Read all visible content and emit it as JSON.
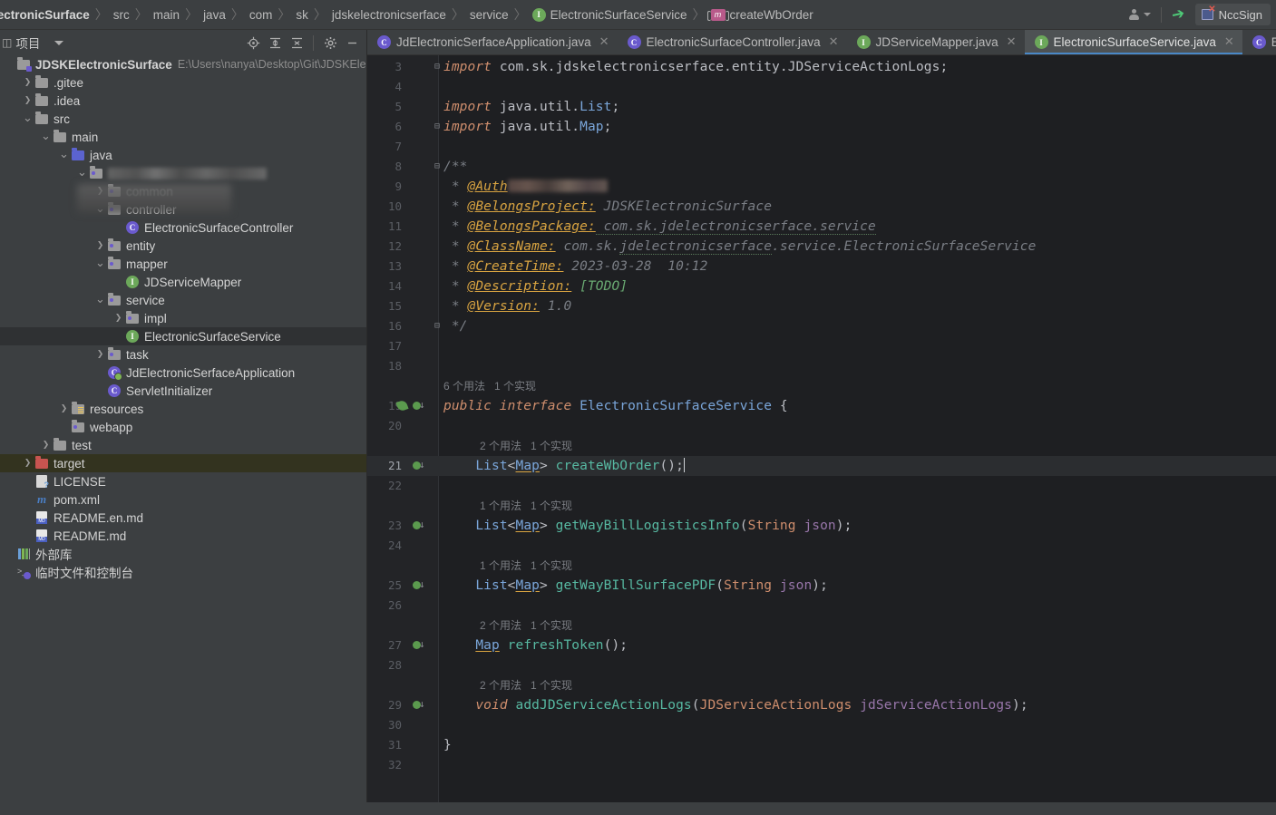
{
  "breadcrumb": {
    "items": [
      {
        "label": "lectronicSurface",
        "icon": null,
        "bold": true
      },
      {
        "label": "src",
        "icon": null
      },
      {
        "label": "main",
        "icon": null
      },
      {
        "label": "java",
        "icon": null
      },
      {
        "label": "com",
        "icon": null
      },
      {
        "label": "sk",
        "icon": null
      },
      {
        "label": "jdskelectronicserface",
        "icon": null
      },
      {
        "label": "service",
        "icon": null
      },
      {
        "label": "ElectronicSurfaceService",
        "icon": "interface-icon"
      },
      {
        "label": "createWbOrder",
        "icon": "method-icon"
      }
    ]
  },
  "topbar_right": {
    "user_icon": "user-icon",
    "hammer_icon": "build-hammer-icon",
    "ncc_sign_label": "NccSign",
    "ncc_sign_icon": "ncc-sign-icon"
  },
  "project_panel": {
    "title": "项目",
    "tools": [
      {
        "name": "locate-icon",
        "glyph": "target"
      },
      {
        "name": "expand-all-icon",
        "glyph": "expand"
      },
      {
        "name": "collapse-all-icon",
        "glyph": "collapse"
      },
      {
        "name": "settings-gear-icon",
        "glyph": "gear"
      },
      {
        "name": "hide-panel-icon",
        "glyph": "minus"
      }
    ],
    "tree": [
      {
        "indent": 0,
        "arrow": "",
        "icon": "project-root-icon",
        "label": "JDSKElectronicSurface",
        "bold": true,
        "sub": "E:\\Users\\nanya\\Desktop\\Git\\JDSKElectronicSurf"
      },
      {
        "indent": 1,
        "arrow": ">",
        "icon": "folder-icon",
        "label": ".gitee"
      },
      {
        "indent": 1,
        "arrow": ">",
        "icon": "folder-icon",
        "label": ".idea"
      },
      {
        "indent": 1,
        "arrow": "v",
        "icon": "folder-icon",
        "label": "src"
      },
      {
        "indent": 2,
        "arrow": "v",
        "icon": "folder-icon",
        "label": "main"
      },
      {
        "indent": 3,
        "arrow": "v",
        "icon": "source-folder-icon",
        "label": "java"
      },
      {
        "indent": 4,
        "arrow": "v",
        "icon": "package-icon",
        "label": "",
        "blurred": true
      },
      {
        "indent": 5,
        "arrow": ">",
        "icon": "package-icon",
        "label": "common",
        "blurred_partial": true
      },
      {
        "indent": 5,
        "arrow": "v",
        "icon": "package-icon",
        "label": "controller"
      },
      {
        "indent": 6,
        "arrow": "",
        "icon": "class-icon",
        "label": "ElectronicSurfaceController"
      },
      {
        "indent": 5,
        "arrow": ">",
        "icon": "package-icon",
        "label": "entity"
      },
      {
        "indent": 5,
        "arrow": "v",
        "icon": "package-icon",
        "label": "mapper"
      },
      {
        "indent": 6,
        "arrow": "",
        "icon": "interface-icon",
        "label": "JDServiceMapper"
      },
      {
        "indent": 5,
        "arrow": "v",
        "icon": "package-icon",
        "label": "service"
      },
      {
        "indent": 6,
        "arrow": ">",
        "icon": "package-icon",
        "label": "impl"
      },
      {
        "indent": 6,
        "arrow": "",
        "icon": "interface-icon",
        "label": "ElectronicSurfaceService",
        "selected": true
      },
      {
        "indent": 5,
        "arrow": ">",
        "icon": "package-icon",
        "label": "task"
      },
      {
        "indent": 5,
        "arrow": "",
        "icon": "spring-class-icon",
        "label": "JdElectronicSerfaceApplication"
      },
      {
        "indent": 5,
        "arrow": "",
        "icon": "class-icon",
        "label": "ServletInitializer"
      },
      {
        "indent": 3,
        "arrow": ">",
        "icon": "resources-folder-icon",
        "label": "resources"
      },
      {
        "indent": 3,
        "arrow": "",
        "icon": "webapp-folder-icon",
        "label": "webapp"
      },
      {
        "indent": 2,
        "arrow": ">",
        "icon": "folder-icon",
        "label": "test"
      },
      {
        "indent": 1,
        "arrow": ">",
        "icon": "target-folder-icon",
        "label": "target",
        "excluded": true
      },
      {
        "indent": 1,
        "arrow": "",
        "icon": "license-file-icon",
        "label": "LICENSE"
      },
      {
        "indent": 1,
        "arrow": "",
        "icon": "maven-pom-icon",
        "label": "pom.xml"
      },
      {
        "indent": 1,
        "arrow": "",
        "icon": "markdown-file-icon",
        "label": "README.en.md"
      },
      {
        "indent": 1,
        "arrow": "",
        "icon": "markdown-file-icon",
        "label": "README.md"
      },
      {
        "indent": 0,
        "arrow": "",
        "icon": "external-libraries-icon",
        "label": "外部库"
      },
      {
        "indent": 0,
        "arrow": "",
        "icon": "scratches-icon",
        "label": "临时文件和控制台"
      }
    ]
  },
  "tabs": [
    {
      "label": "JdElectronicSerfaceApplication.java",
      "icon": "spring-class-icon",
      "active": false
    },
    {
      "label": "ElectronicSurfaceController.java",
      "icon": "class-icon",
      "active": false
    },
    {
      "label": "JDServiceMapper.java",
      "icon": "interface-icon",
      "active": false
    },
    {
      "label": "ElectronicSurfaceService.java",
      "icon": "interface-icon",
      "active": true
    },
    {
      "label": "ElectronicSurfaceServiceIm",
      "icon": "class-icon",
      "active": false
    }
  ],
  "editor": {
    "current_line": 21,
    "lines": [
      {
        "n": 3,
        "fold": "⊟",
        "html": "<span class=\"kw\">import</span> <span class=\"pln\">com.sk.jdskelectronicserface.entity.JDServiceActionLogs</span><span class=\"pln\">;</span>"
      },
      {
        "n": 4,
        "html": ""
      },
      {
        "n": 5,
        "html": "<span class=\"kw\">import</span> <span class=\"pln\">java.util.</span><span class=\"typ\">List</span><span class=\"pln\">;</span>"
      },
      {
        "n": 6,
        "fold": "⊟",
        "html": "<span class=\"kw\">import</span> <span class=\"pln\">java.util.</span><span class=\"typ\">Map</span><span class=\"pln\">;</span>"
      },
      {
        "n": 7,
        "html": ""
      },
      {
        "n": 8,
        "fold": "⊟",
        "html": "<span class=\"cmt\">/**</span>"
      },
      {
        "n": 9,
        "html": "<span class=\"cmt\"> * </span><span class=\"tag\">@Auth</span><span class=\"code-blur\" style=\"width:110px\"></span>"
      },
      {
        "n": 10,
        "html": "<span class=\"cmt\"> * </span><span class=\"tag\">@BelongsProject:</span><span class=\"cmt\"> JDSKElectronicSurface</span>"
      },
      {
        "n": 11,
        "html": "<span class=\"cmt\"> * </span><span class=\"tag\">@BelongsPackage:</span><span class=\"cmt wavy\"> com.sk.jdelectronicserface.service</span>"
      },
      {
        "n": 12,
        "html": "<span class=\"cmt\"> * </span><span class=\"tag\">@ClassName:</span><span class=\"cmt\"> com.sk.</span><span class=\"cmt wavy\">jdelectronicserface</span><span class=\"cmt\">.service.ElectronicSurfaceService</span>"
      },
      {
        "n": 13,
        "html": "<span class=\"cmt\"> * </span><span class=\"tag\">@CreateTime:</span><span class=\"cmt\"> 2023-03-28  10:12</span>"
      },
      {
        "n": 14,
        "html": "<span class=\"cmt\"> * </span><span class=\"tag\">@Description:</span><span class=\"todo\"> [TODO]</span>"
      },
      {
        "n": 15,
        "html": "<span class=\"cmt\"> * </span><span class=\"tag\">@Version:</span><span class=\"cmt\"> 1.0</span>"
      },
      {
        "n": 16,
        "fold": "⊟",
        "html": "<span class=\"cmt\"> */</span>"
      },
      {
        "n": 17,
        "html": ""
      },
      {
        "n": 18,
        "html": ""
      },
      {
        "n": 19,
        "hint": "6 个用法   1 个实现",
        "hint_indent": 0,
        "leaf": true,
        "impl": true,
        "html": "<span class=\"kw\">public interface </span><span class=\"typ\">ElectronicSurfaceService</span><span class=\"pln\"> {</span>"
      },
      {
        "n": 20,
        "html": ""
      },
      {
        "n": 21,
        "hint": "2 个用法   1 个实现",
        "hint_indent": 40,
        "impl": true,
        "current": true,
        "html": "    <span class=\"typ\">List</span><span class=\"pln\">&lt;</span><span class=\"typ sqz\">Map</span><span class=\"pln\">&gt; </span><span class=\"mthg\">createWbOrder</span><span class=\"pln\">();</span><span class=\"caret-line\"></span>"
      },
      {
        "n": 22,
        "html": ""
      },
      {
        "n": 23,
        "hint": "1 个用法   1 个实现",
        "hint_indent": 40,
        "impl": true,
        "html": "    <span class=\"typ\">List</span><span class=\"pln\">&lt;</span><span class=\"typ sqz\">Map</span><span class=\"pln\">&gt; </span><span class=\"mthg\">getWayBillLogisticsInfo</span><span class=\"pln\">(</span><span class=\"strtype\">String</span><span class=\"pln\"> </span><span class=\"param\">json</span><span class=\"pln\">);</span>"
      },
      {
        "n": 24,
        "html": ""
      },
      {
        "n": 25,
        "hint": "1 个用法   1 个实现",
        "hint_indent": 40,
        "impl": true,
        "html": "    <span class=\"typ\">List</span><span class=\"pln\">&lt;</span><span class=\"typ sqz\">Map</span><span class=\"pln\">&gt; </span><span class=\"mthg\">getWayBIllSurfacePDF</span><span class=\"pln\">(</span><span class=\"strtype\">String</span><span class=\"pln\"> </span><span class=\"param\">json</span><span class=\"pln\">);</span>"
      },
      {
        "n": 26,
        "html": ""
      },
      {
        "n": 27,
        "hint": "2 个用法   1 个实现",
        "hint_indent": 40,
        "impl": true,
        "html": "    <span class=\"typ sqz\">Map</span><span class=\"pln\"> </span><span class=\"mthg\">refreshToken</span><span class=\"pln\">();</span>"
      },
      {
        "n": 28,
        "html": ""
      },
      {
        "n": 29,
        "hint": "2 个用法   1 个实现",
        "hint_indent": 40,
        "impl": true,
        "html": "    <span class=\"kw\">void</span><span class=\"pln\"> </span><span class=\"mthg\">addJDServiceActionLogs</span><span class=\"pln\">(</span><span class=\"strtype\">JDServiceActionLogs</span><span class=\"pln\"> </span><span class=\"param\">jdServiceActionLogs</span><span class=\"pln\">);</span>"
      },
      {
        "n": 30,
        "html": ""
      },
      {
        "n": 31,
        "html": "<span class=\"pln\">}</span>"
      },
      {
        "n": 32,
        "html": ""
      }
    ]
  }
}
